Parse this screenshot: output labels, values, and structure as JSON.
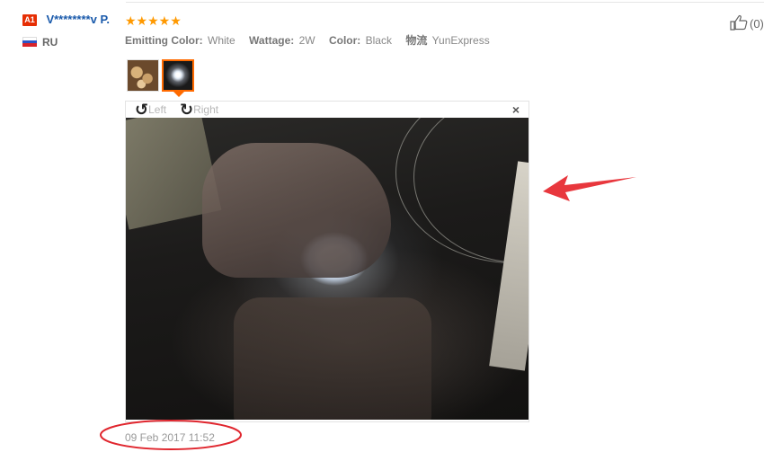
{
  "buyer": {
    "level_badge": "A1",
    "name": "V********v P.",
    "country_code": "RU"
  },
  "review": {
    "stars": "★★★★★",
    "rating": 5,
    "attributes": [
      {
        "key": "Emitting Color:",
        "value": "White"
      },
      {
        "key": "Wattage:",
        "value": "2W"
      },
      {
        "key": "Color:",
        "value": "Black"
      },
      {
        "key": "物流",
        "value": "YunExpress"
      }
    ],
    "date": "09 Feb 2017 11:52"
  },
  "viewer": {
    "rotate_left_label": "Left",
    "rotate_right_label": "Right",
    "close_glyph": "×"
  },
  "helpful": {
    "count": "(0)"
  },
  "colors": {
    "accent": "#ff6a00",
    "link": "#1a5aab",
    "annotation": "#e8373d",
    "star": "#ff9900"
  }
}
